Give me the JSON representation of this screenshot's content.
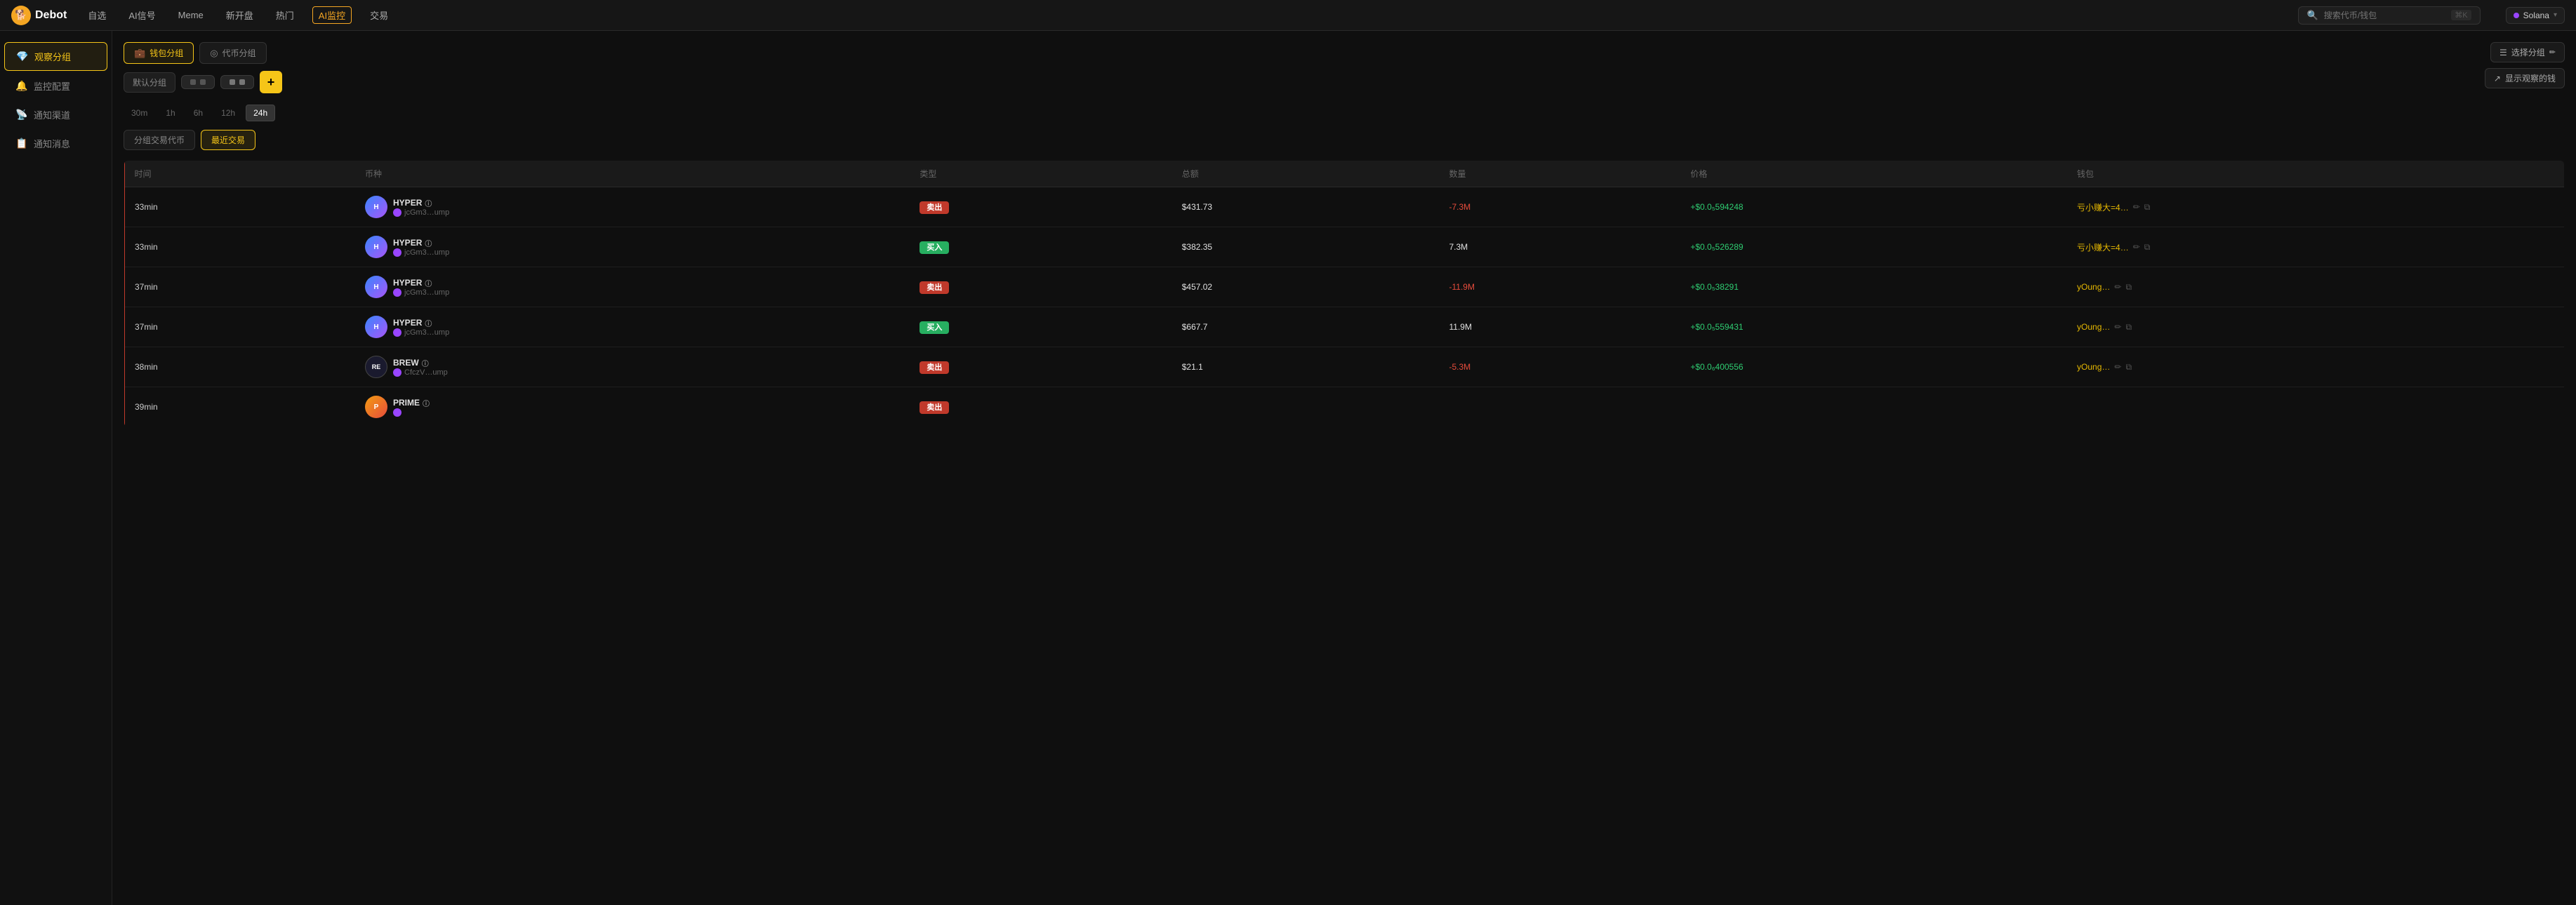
{
  "logo": {
    "icon": "🐕",
    "name": "Debot"
  },
  "nav": {
    "links": [
      {
        "label": "自选",
        "id": "zixuan",
        "active": false
      },
      {
        "label": "AI信号",
        "id": "ai-signal",
        "active": false
      },
      {
        "label": "Meme",
        "id": "meme",
        "active": false
      },
      {
        "label": "新开盘",
        "id": "new-listing",
        "active": false
      },
      {
        "label": "热门",
        "id": "hot",
        "active": false
      },
      {
        "label": "AI监控",
        "id": "ai-monitor",
        "active": true
      },
      {
        "label": "交易",
        "id": "trade",
        "active": false
      }
    ],
    "search_placeholder": "搜索代币/钱包",
    "search_shortcut": "⌘K",
    "network": "Solana"
  },
  "sidebar": {
    "items": [
      {
        "label": "观察分组",
        "id": "watch-group",
        "icon": "💎",
        "active": true
      },
      {
        "label": "监控配置",
        "id": "monitor-config",
        "icon": "🔔",
        "active": false
      },
      {
        "label": "通知渠道",
        "id": "notify-channel",
        "icon": "📡",
        "active": false
      },
      {
        "label": "通知消息",
        "id": "notify-msg",
        "icon": "📋",
        "active": false
      }
    ]
  },
  "tabs": {
    "wallet_group": "钱包分组",
    "token_group": "代币分组"
  },
  "groups": {
    "default_label": "默认分组",
    "tag1_dots": 2,
    "add_label": "+"
  },
  "time_filters": [
    "30m",
    "1h",
    "6h",
    "12h",
    "24h"
  ],
  "active_time": "24h",
  "sub_tabs": {
    "group_tx": "分组交易代币",
    "recent_tx": "最近交易"
  },
  "active_sub_tab": "recent_tx",
  "table": {
    "headers": [
      "时间",
      "币种",
      "类型",
      "总额",
      "数量",
      "价格",
      "钱包"
    ],
    "rows": [
      {
        "time": "33min",
        "token_name": "HYPER",
        "token_addr": "jcGm3…ump",
        "token_logo": "H",
        "type": "sell",
        "type_label": "卖出",
        "amount": "$431.73",
        "qty": "-7.3M",
        "price": "+$0.0₅594248",
        "wallet": "亏小赚大=4…",
        "has_copy": true
      },
      {
        "time": "33min",
        "token_name": "HYPER",
        "token_addr": "jcGm3…ump",
        "token_logo": "H",
        "type": "buy",
        "type_label": "买入",
        "amount": "$382.35",
        "qty": "7.3M",
        "price": "+$0.0₅526289",
        "wallet": "亏小赚大=4…",
        "has_copy": true
      },
      {
        "time": "37min",
        "token_name": "HYPER",
        "token_addr": "jcGm3…ump",
        "token_logo": "H",
        "type": "sell",
        "type_label": "卖出",
        "amount": "$457.02",
        "qty": "-11.9M",
        "price": "+$0.0₅38291",
        "wallet": "yOung…",
        "has_copy": true
      },
      {
        "time": "37min",
        "token_name": "HYPER",
        "token_addr": "jcGm3…ump",
        "token_logo": "H",
        "type": "buy",
        "type_label": "买入",
        "amount": "$667.7",
        "qty": "11.9M",
        "price": "+$0.0₅559431",
        "wallet": "yOung…",
        "has_copy": true
      },
      {
        "time": "38min",
        "token_name": "BREW",
        "token_addr": "CfczV…ump",
        "token_logo": "RE",
        "type": "sell",
        "type_label": "卖出",
        "amount": "$21.1",
        "qty": "-5.3M",
        "price": "+$0.0₆400556",
        "wallet": "yOung…",
        "has_copy": true
      },
      {
        "time": "39min",
        "token_name": "PRIME",
        "token_addr": "",
        "token_logo": "P",
        "type": "sell",
        "type_label": "卖出",
        "amount": "",
        "qty": "",
        "price": "",
        "wallet": "",
        "has_copy": false
      }
    ]
  },
  "right_actions": {
    "select_group": "选择分组",
    "show_watch": "显示观察的钱"
  },
  "icons": {
    "edit": "✏️",
    "copy": "⧉",
    "verify": "ⓘ",
    "chevron_down": "▾",
    "search": "🔍",
    "list": "☰",
    "pen": "✏"
  }
}
